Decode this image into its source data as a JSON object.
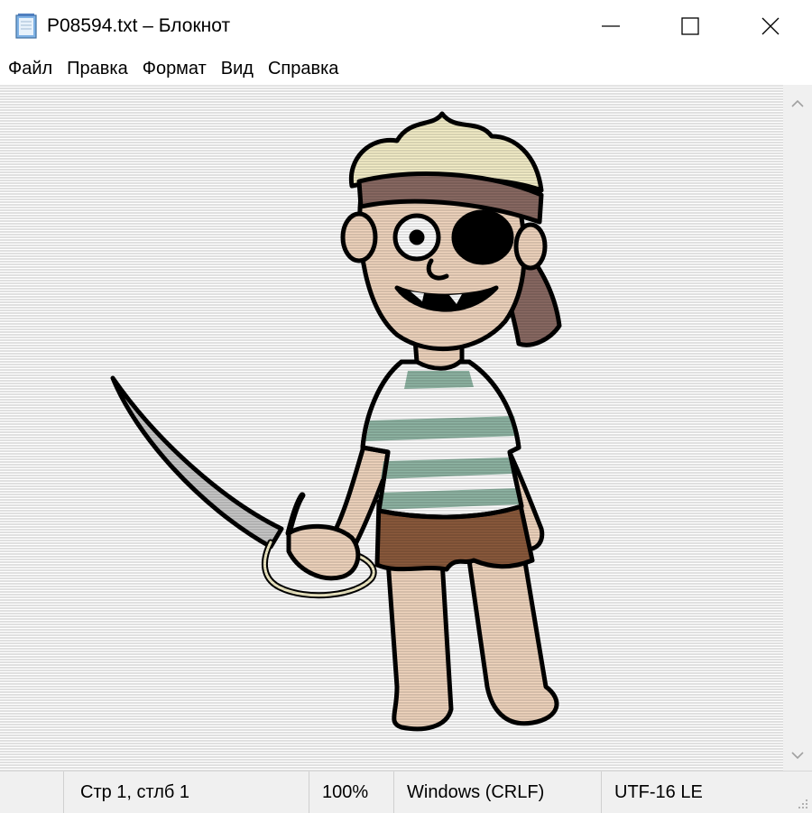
{
  "window": {
    "title": "P08594.txt – Блокнот",
    "app_icon": "notepad-icon",
    "controls": [
      "minimize-icon",
      "maximize-icon",
      "close-icon"
    ]
  },
  "menu": {
    "items": [
      {
        "label": "Файл"
      },
      {
        "label": "Правка"
      },
      {
        "label": "Формат"
      },
      {
        "label": "Вид"
      },
      {
        "label": "Справка"
      }
    ]
  },
  "editor": {
    "content": "ASCII-art image of a cartoon pirate boy holding a sword",
    "colors": {
      "skin": "#f1d6bf",
      "hair": "#f5efc9",
      "bandana": "#8a6a63",
      "stripes": "#8fb5a4",
      "shorts": "#8b5a3c",
      "blade": "#c9c9c9",
      "outline": "#000000"
    }
  },
  "statusbar": {
    "position": "Стр 1, стлб 1",
    "zoom": "100%",
    "line_ending": "Windows (CRLF)",
    "encoding": "UTF-16 LE"
  }
}
